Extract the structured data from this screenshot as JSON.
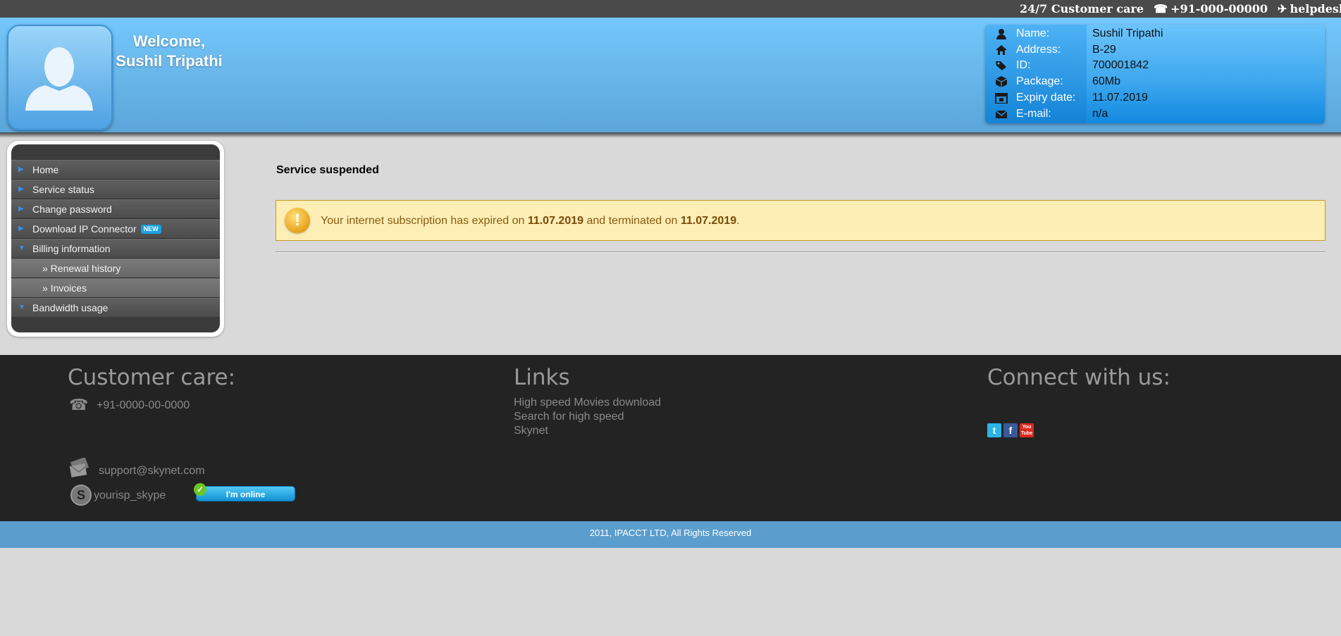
{
  "topbar": {
    "customer_care": "24/7 Customer care",
    "phone": "+91-000-00000",
    "helpdesk": "helpdesk"
  },
  "header": {
    "welcome": "Welcome,",
    "user_name": "Sushil Tripathi"
  },
  "user_info": {
    "name_label": "Name:",
    "name_value": "Sushil Tripathi",
    "address_label": "Address:",
    "address_value": "B-29",
    "id_label": "ID:",
    "id_value": "700001842",
    "package_label": "Package:",
    "package_value": "60Mb",
    "expiry_label": "Expiry date:",
    "expiry_value": "11.07.2019",
    "email_label": "E-mail:",
    "email_value": "n/a"
  },
  "menu": {
    "home": "Home",
    "service_status": "Service status",
    "change_password": "Change password",
    "download_ip": "Download IP Connector",
    "new_badge": "NEW",
    "billing": "Billing information",
    "renewal_history": "» Renewal history",
    "invoices": "» Invoices",
    "bandwidth": "Bandwidth usage"
  },
  "main": {
    "title": "Service suspended",
    "notice_prefix": "Your internet subscription has expired on ",
    "expired_date": "11.07.2019",
    "notice_middle": " and terminated on ",
    "terminated_date": "11.07.2019",
    "notice_suffix": "."
  },
  "footer": {
    "customer_care_heading": "Customer care:",
    "phone": "+91-0000-00-0000",
    "email": "support@skynet.com",
    "skype": "yourisp_skype",
    "online_label": "I'm online",
    "links_heading": "Links",
    "links": [
      "High speed Movies download",
      "Search for high speed",
      "Skynet"
    ],
    "connect_heading": "Connect with us:",
    "youtube_label": "You Tube"
  },
  "copyright": "2011, IPACCT LTD, All Rights Reserved",
  "colors": {
    "header_blue": "#6ab8ec",
    "menu_arrow": "#3d8fe0",
    "notice_bg": "#fdeeb5",
    "footer_bg": "#232323",
    "copyright_bg": "#5b9dcc"
  }
}
